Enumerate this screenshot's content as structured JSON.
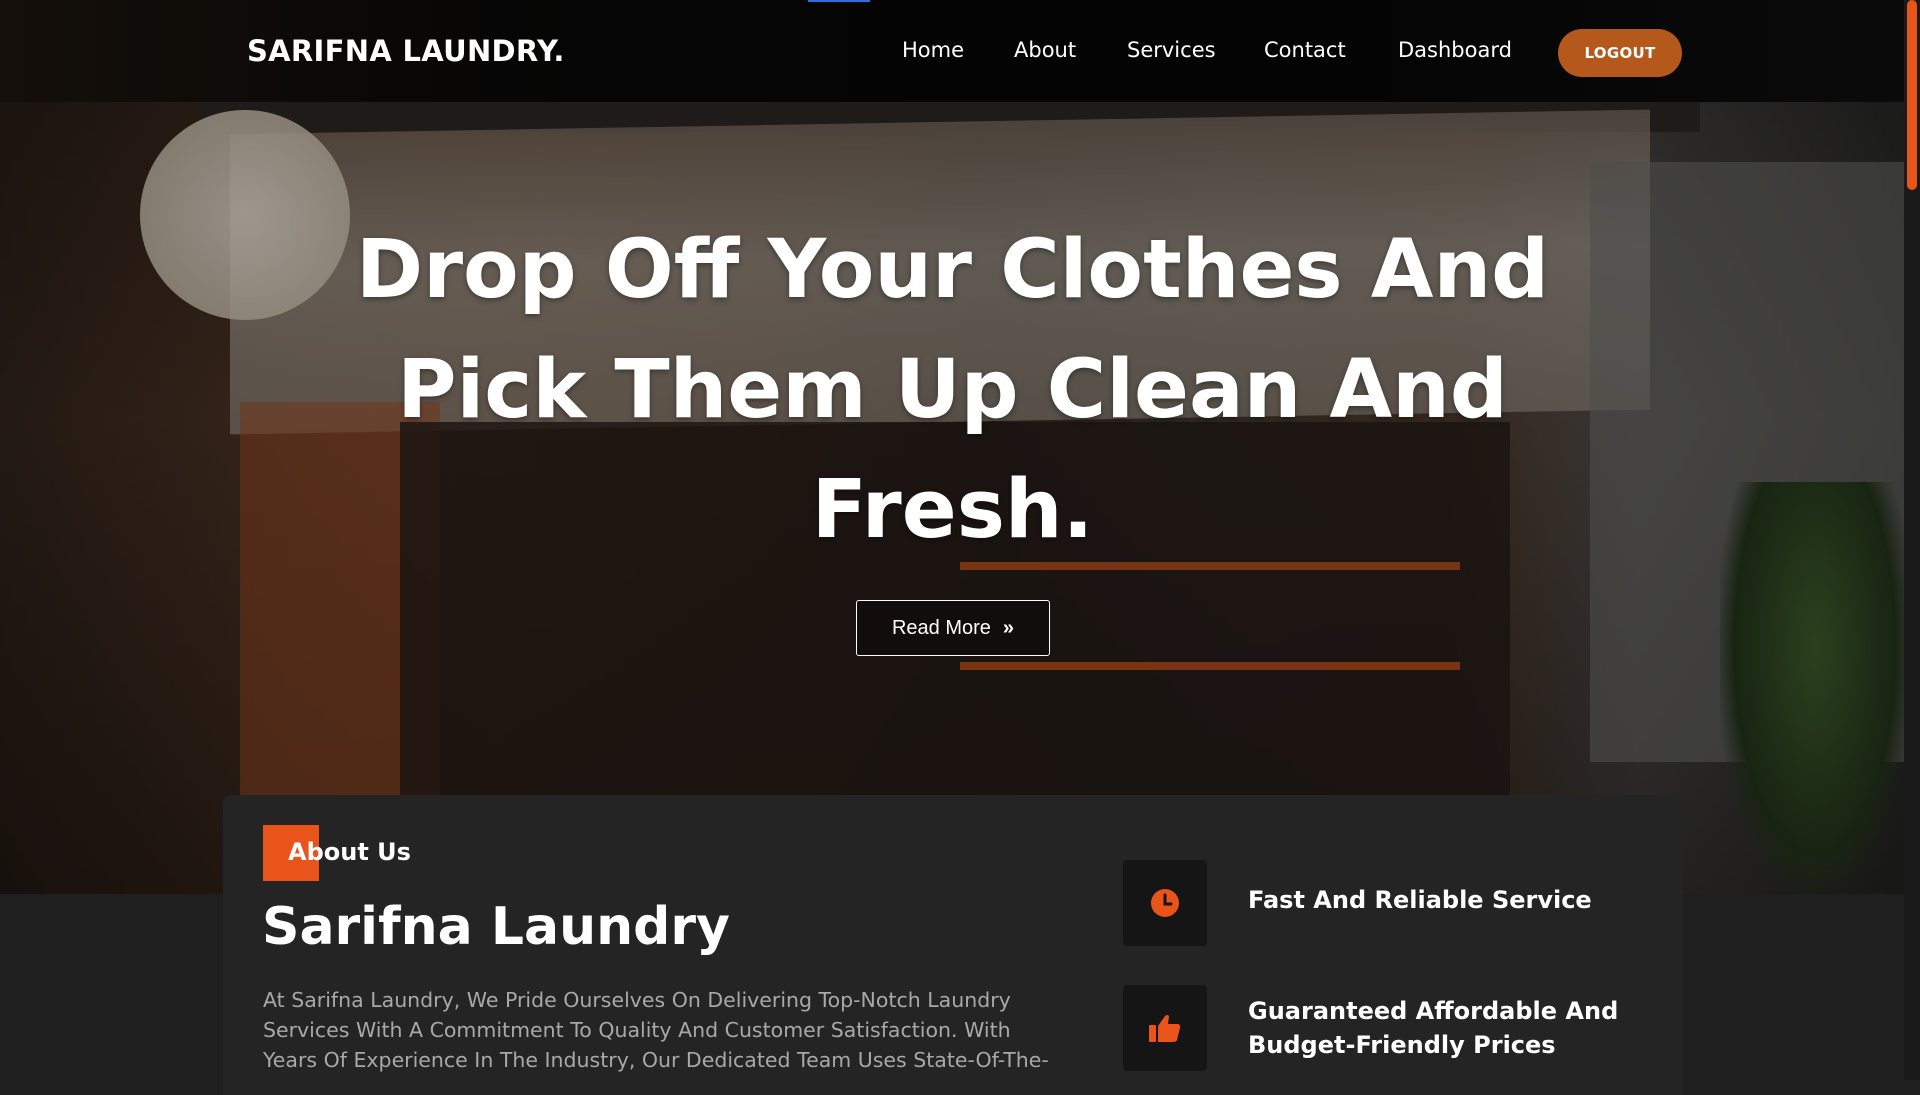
{
  "brand": "SARIFNA LAUNDRY.",
  "nav": {
    "items": [
      "Home",
      "About",
      "Services",
      "Contact",
      "Dashboard"
    ],
    "logout_label": "LOGOUT"
  },
  "hero": {
    "title": "Drop Off Your Clothes And Pick Them Up Clean And Fresh.",
    "button_label": "Read More",
    "button_icon": "double-chevron-right-icon"
  },
  "about": {
    "tag": "About Us",
    "title": "Sarifna Laundry",
    "body": "At Sarifna Laundry, We Pride Ourselves On Delivering Top-Notch Laundry Services With A Commitment To Quality And Customer Satisfaction. With Years Of Experience In The Industry, Our Dedicated Team Uses State-Of-The-",
    "features": [
      {
        "icon": "clock-icon",
        "text": "Fast And Reliable Service"
      },
      {
        "icon": "thumbs-up-icon",
        "text": "Guaranteed Affordable And Budget-Friendly Prices"
      }
    ]
  },
  "colors": {
    "accent": "#e8541a",
    "logout_bg": "#b4581c",
    "card_bg": "#242424",
    "page_bg": "#1f1f1f"
  }
}
